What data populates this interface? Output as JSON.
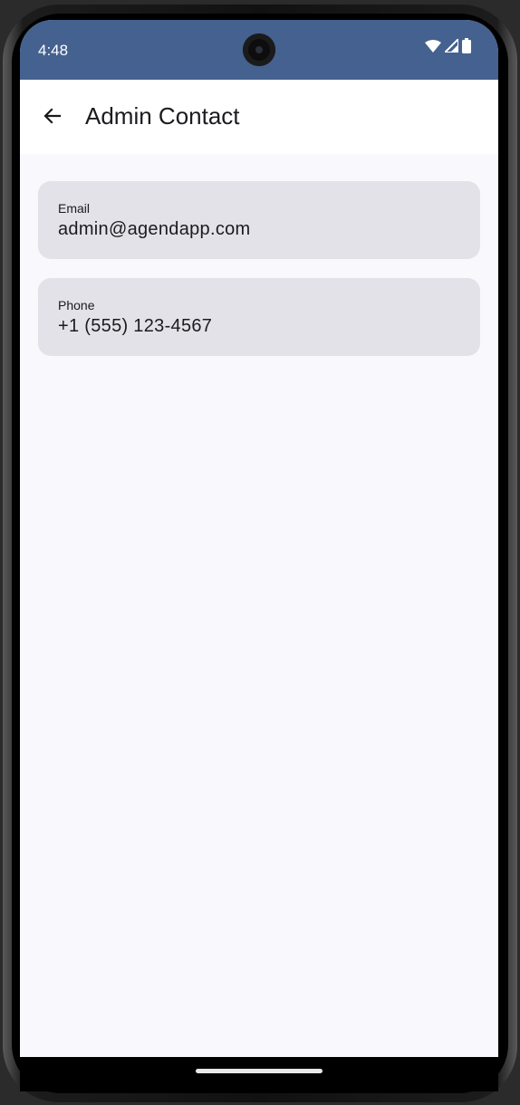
{
  "status_bar": {
    "time": "4:48",
    "icons": [
      "wifi-icon",
      "cellular-signal-icon",
      "battery-icon"
    ],
    "color": "#44618f"
  },
  "app_bar": {
    "back_icon": "arrow-back-icon",
    "title": "Admin Contact"
  },
  "contacts": [
    {
      "label": "Email",
      "value": "admin@agendapp.com"
    },
    {
      "label": "Phone",
      "value": "+1 (555) 123-4567"
    }
  ],
  "colors": {
    "card_background": "#e3e2e8",
    "screen_background": "#f8f8fd"
  }
}
